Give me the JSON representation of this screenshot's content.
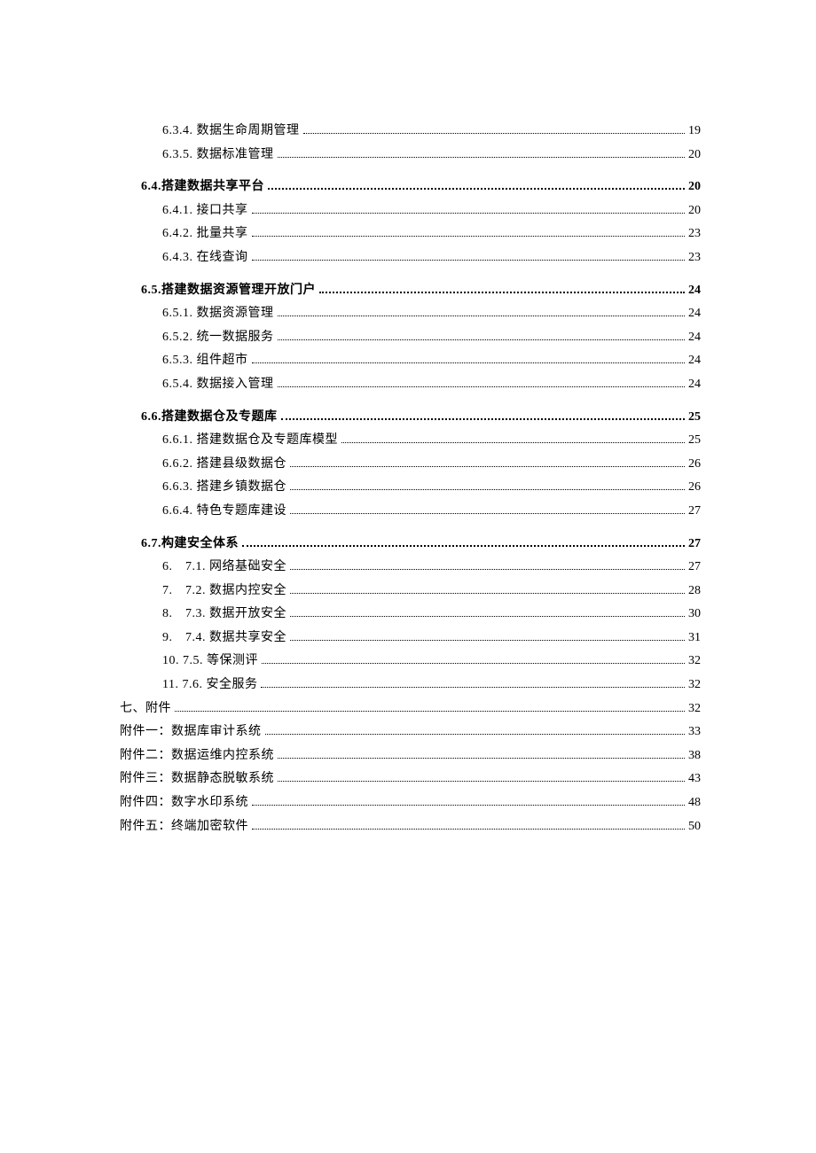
{
  "entries": [
    {
      "label": "6.3.4. 数据生命周期管理",
      "page": "19",
      "indent": 1,
      "bold": false,
      "gap": false
    },
    {
      "label": "6.3.5. 数据标准管理",
      "page": "20",
      "indent": 1,
      "bold": false,
      "gap": false
    },
    {
      "label": "6.4.搭建数据共享平台",
      "page": "20",
      "indent": 0.5,
      "bold": true,
      "gap": true
    },
    {
      "label": "6.4.1. 接口共享",
      "page": "20",
      "indent": 1,
      "bold": false,
      "gap": false
    },
    {
      "label": "6.4.2. 批量共享",
      "page": "23",
      "indent": 1,
      "bold": false,
      "gap": false
    },
    {
      "label": "6.4.3. 在线查询",
      "page": "23",
      "indent": 1,
      "bold": false,
      "gap": false
    },
    {
      "label": "6.5.搭建数据资源管理开放门户",
      "page": "24",
      "indent": 0.5,
      "bold": true,
      "gap": true
    },
    {
      "label": "6.5.1. 数据资源管理",
      "page": "24",
      "indent": 1,
      "bold": false,
      "gap": false
    },
    {
      "label": "6.5.2. 统一数据服务",
      "page": "24",
      "indent": 1,
      "bold": false,
      "gap": false
    },
    {
      "label": "6.5.3. 组件超市",
      "page": "24",
      "indent": 1,
      "bold": false,
      "gap": false
    },
    {
      "label": "6.5.4. 数据接入管理",
      "page": "24",
      "indent": 1,
      "bold": false,
      "gap": false
    },
    {
      "label": "6.6.搭建数据仓及专题库",
      "page": "25",
      "indent": 0.5,
      "bold": true,
      "gap": true
    },
    {
      "label": "6.6.1. 搭建数据仓及专题库模型",
      "page": "25",
      "indent": 1,
      "bold": false,
      "gap": false
    },
    {
      "label": "6.6.2. 搭建县级数据仓",
      "page": "26",
      "indent": 1,
      "bold": false,
      "gap": false
    },
    {
      "label": "6.6.3. 搭建乡镇数据仓",
      "page": "26",
      "indent": 1,
      "bold": false,
      "gap": false
    },
    {
      "label": "6.6.4. 特色专题库建设",
      "page": "27",
      "indent": 1,
      "bold": false,
      "gap": false
    },
    {
      "label": "6.7.构建安全体系",
      "page": "27",
      "indent": 0.5,
      "bold": true,
      "gap": true
    },
    {
      "label": "6.　7.1. 网络基础安全",
      "page": "27",
      "indent": 1,
      "bold": false,
      "gap": false
    },
    {
      "label": "7.　7.2. 数据内控安全",
      "page": "28",
      "indent": 1,
      "bold": false,
      "gap": false
    },
    {
      "label": "8.　7.3. 数据开放安全",
      "page": "30",
      "indent": 1,
      "bold": false,
      "gap": false
    },
    {
      "label": "9.　7.4. 数据共享安全",
      "page": "31",
      "indent": 1,
      "bold": false,
      "gap": false
    },
    {
      "label": "10. 7.5. 等保测评",
      "page": "32",
      "indent": 1,
      "bold": false,
      "gap": false
    },
    {
      "label": "11. 7.6. 安全服务",
      "page": "32",
      "indent": 1,
      "bold": false,
      "gap": false
    },
    {
      "label": "七、附件",
      "page": "32",
      "indent": 0,
      "bold": false,
      "gap": false
    },
    {
      "label": "附件一：数据库审计系统",
      "page": "33",
      "indent": 0,
      "bold": false,
      "gap": false
    },
    {
      "label": "附件二：数据运维内控系统",
      "page": "38",
      "indent": 0,
      "bold": false,
      "gap": false
    },
    {
      "label": "附件三：数据静态脱敏系统",
      "page": "43",
      "indent": 0,
      "bold": false,
      "gap": false
    },
    {
      "label": "附件四：数字水印系统",
      "page": "48",
      "indent": 0,
      "bold": false,
      "gap": false
    },
    {
      "label": "附件五：终端加密软件",
      "page": "50",
      "indent": 0,
      "bold": false,
      "gap": false
    }
  ]
}
